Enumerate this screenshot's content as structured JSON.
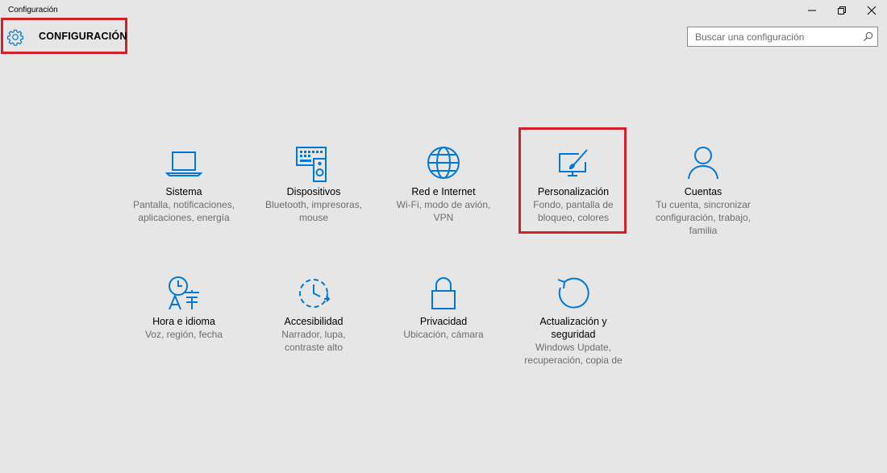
{
  "window": {
    "title": "Configuración"
  },
  "header": {
    "title": "CONFIGURACIÓN"
  },
  "search": {
    "placeholder": "Buscar una configuración"
  },
  "colors": {
    "accent": "#0078d7",
    "highlight": "#d0202a",
    "background": "#e6e6e6"
  },
  "tiles": [
    {
      "icon": "laptop-icon",
      "name": "Sistema",
      "desc": [
        "Pantalla, notificaciones,",
        "aplicaciones, energía"
      ]
    },
    {
      "icon": "keyboard-speaker-icon",
      "name": "Dispositivos",
      "desc": [
        "Bluetooth, impresoras,",
        "mouse"
      ]
    },
    {
      "icon": "globe-icon",
      "name": "Red e Internet",
      "desc": [
        "Wi-Fi, modo de avión,",
        "VPN"
      ]
    },
    {
      "icon": "paint-monitor-icon",
      "name": "Personalización",
      "desc": [
        "Fondo, pantalla de",
        "bloqueo, colores"
      ]
    },
    {
      "icon": "person-icon",
      "name": "Cuentas",
      "desc": [
        "Tu cuenta, sincronizar",
        "configuración, trabajo,",
        "familia"
      ]
    },
    {
      "icon": "time-language-icon",
      "name": "Hora e idioma",
      "desc": [
        "Voz, región, fecha"
      ]
    },
    {
      "icon": "accessibility-icon",
      "name": "Accesibilidad",
      "desc": [
        "Narrador, lupa,",
        "contraste alto"
      ]
    },
    {
      "icon": "lock-icon",
      "name": "Privacidad",
      "desc": [
        "Ubicación, cámara"
      ]
    },
    {
      "icon": "update-icon",
      "name": [
        "Actualización y",
        "seguridad"
      ],
      "desc": [
        "Windows Update,",
        "recuperación, copia de"
      ]
    }
  ]
}
